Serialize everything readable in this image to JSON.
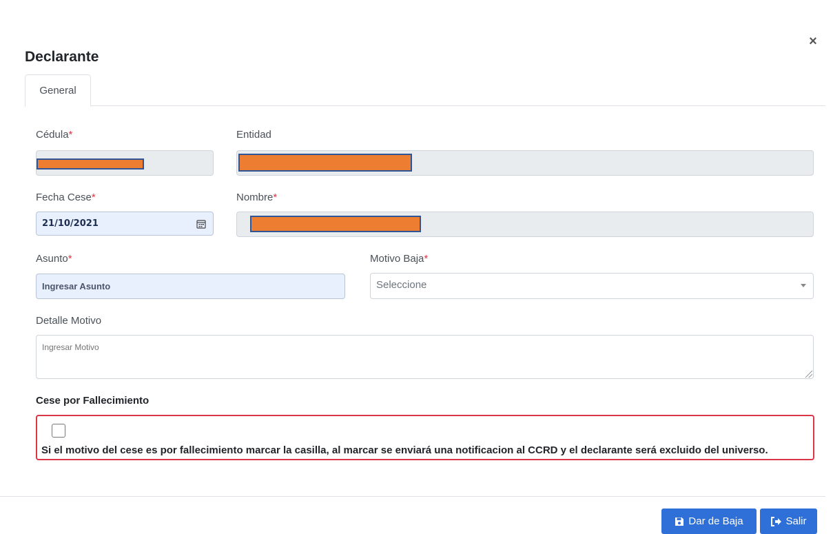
{
  "modal": {
    "title": "Declarante",
    "close_glyph": "×"
  },
  "tabs": [
    {
      "label": "General",
      "active": true
    }
  ],
  "form": {
    "cedula": {
      "label": "Cédula",
      "required_mark": "*"
    },
    "entidad": {
      "label": "Entidad"
    },
    "fecha_cese": {
      "label": "Fecha Cese",
      "required_mark": "*",
      "value": "21/10/2021"
    },
    "nombre": {
      "label": "Nombre",
      "required_mark": "*"
    },
    "asunto": {
      "label": "Asunto",
      "required_mark": "*",
      "placeholder": "Ingresar Asunto"
    },
    "motivo_baja": {
      "label": "Motivo Baja",
      "required_mark": "*",
      "selected": "Seleccione"
    },
    "detalle_motivo": {
      "label": "Detalle Motivo",
      "placeholder": "Ingresar Motivo"
    }
  },
  "fallecimiento": {
    "title": "Cese por Fallecimiento",
    "checked": false,
    "text": "Si el motivo del cese es por fallecimiento marcar la casilla, al marcar se enviará una notificacion al CCRD y el declarante será excluido del universo."
  },
  "footer": {
    "dar_de_baja_label": "Dar de Baja",
    "salir_label": "Salir"
  },
  "colors": {
    "primary": "#2f6fd8",
    "danger": "#dc3545",
    "redaction": "#ed7d31"
  },
  "icons": {
    "close": "close-icon",
    "calendar": "calendar-icon",
    "dropdown": "chevron-down-icon",
    "save": "save-icon",
    "exit": "sign-out-icon"
  }
}
